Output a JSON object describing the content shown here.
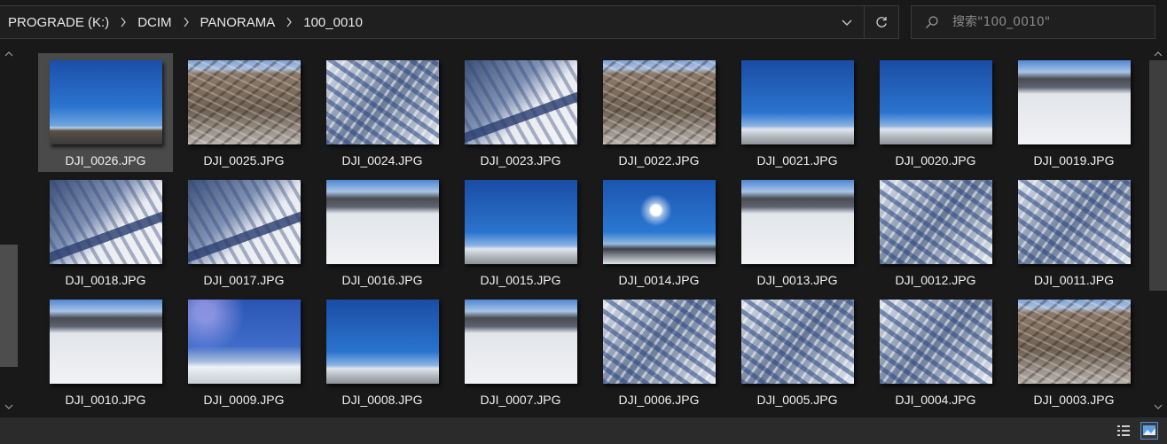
{
  "breadcrumb": [
    "PROGRADE (K:)",
    "DCIM",
    "PANORAMA",
    "100_0010"
  ],
  "search": {
    "placeholder": "搜索\"100_0010\""
  },
  "icons": {
    "breadcrumb_separator": "chevron-right-icon",
    "dropdown": "chevron-down-icon",
    "refresh": "refresh-icon",
    "search": "search-icon",
    "view_details": "details-view-icon",
    "view_large": "large-icons-view-icon"
  },
  "colors": {
    "background": "#191919",
    "selected_tile": "#4a4a4a",
    "text": "#f0f0f0",
    "placeholder": "#8a8a8a"
  },
  "selected_file": "DJI_0026.JPG",
  "files": [
    {
      "name": "DJI_0026.JPG",
      "thumb": "sky"
    },
    {
      "name": "DJI_0025.JPG",
      "thumb": "town"
    },
    {
      "name": "DJI_0024.JPG",
      "thumb": "snowtown"
    },
    {
      "name": "DJI_0023.JPG",
      "thumb": "field"
    },
    {
      "name": "DJI_0022.JPG",
      "thumb": "town"
    },
    {
      "name": "DJI_0021.JPG",
      "thumb": "sky2"
    },
    {
      "name": "DJI_0020.JPG",
      "thumb": "sky2"
    },
    {
      "name": "DJI_0019.JPG",
      "thumb": "fieldh"
    },
    {
      "name": "DJI_0018.JPG",
      "thumb": "field"
    },
    {
      "name": "DJI_0017.JPG",
      "thumb": "field"
    },
    {
      "name": "DJI_0016.JPG",
      "thumb": "fieldh"
    },
    {
      "name": "DJI_0015.JPG",
      "thumb": "sky2"
    },
    {
      "name": "DJI_0014.JPG",
      "thumb": "sun"
    },
    {
      "name": "DJI_0013.JPG",
      "thumb": "fieldh"
    },
    {
      "name": "DJI_0012.JPG",
      "thumb": "snowtown"
    },
    {
      "name": "DJI_0011.JPG",
      "thumb": "snowtown"
    },
    {
      "name": "DJI_0010.JPG",
      "thumb": "fieldh"
    },
    {
      "name": "DJI_0009.JPG",
      "thumb": "violet"
    },
    {
      "name": "DJI_0008.JPG",
      "thumb": "sky2"
    },
    {
      "name": "DJI_0007.JPG",
      "thumb": "fieldh"
    },
    {
      "name": "DJI_0006.JPG",
      "thumb": "snowtown"
    },
    {
      "name": "DJI_0005.JPG",
      "thumb": "snowtown"
    },
    {
      "name": "DJI_0004.JPG",
      "thumb": "snowtown"
    },
    {
      "name": "DJI_0003.JPG",
      "thumb": "town"
    }
  ]
}
